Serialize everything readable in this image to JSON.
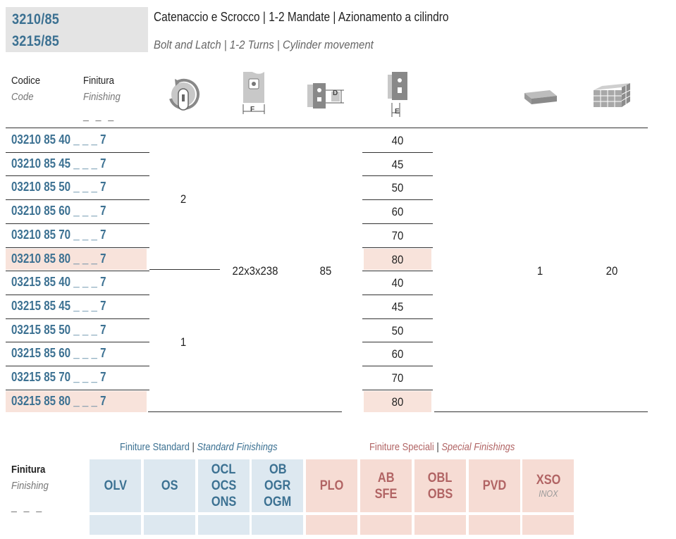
{
  "header": {
    "models": [
      "3210/85",
      "3215/85"
    ],
    "title_it": "Catenaccio e Scrocco | 1-2 Mandate | Azionamento a cilindro",
    "title_en": "Bolt and Latch | 1-2 Turns | Cylinder movement"
  },
  "columns": {
    "code_it": "Codice",
    "code_en": "Code",
    "finish_it": "Finitura",
    "finish_en": "Finishing",
    "finish_placeholder": "_ _ _",
    "icon_turns": "cylinder-turns-icon",
    "icon_faceplate": "faceplate-icon",
    "faceplate_label": "F",
    "icon_backset_d": "backset-icon",
    "backset_label": "D",
    "icon_backset_e": "entrance-icon",
    "entrance_label": "E",
    "icon_pack": "pack-icon",
    "icon_box": "box-icon"
  },
  "rows": [
    {
      "code": "03210 85 40 _ _ _ 7",
      "e": "40",
      "highlight": false
    },
    {
      "code": "03210 85 45 _ _ _ 7",
      "e": "45",
      "highlight": false
    },
    {
      "code": "03210 85 50 _ _ _ 7",
      "e": "50",
      "highlight": false
    },
    {
      "code": "03210 85 60 _ _ _ 7",
      "e": "60",
      "highlight": false
    },
    {
      "code": "03210 85 70 _ _ _ 7",
      "e": "70",
      "highlight": false
    },
    {
      "code": "03210 85 80 _ _ _ 7",
      "e": "80",
      "highlight": true
    },
    {
      "code": "03215 85 40 _ _ _ 7",
      "e": "40",
      "highlight": false
    },
    {
      "code": "03215 85 45 _ _ _ 7",
      "e": "45",
      "highlight": false
    },
    {
      "code": "03215 85 50 _ _ _ 7",
      "e": "50",
      "highlight": false
    },
    {
      "code": "03215 85 60 _ _ _ 7",
      "e": "60",
      "highlight": false
    },
    {
      "code": "03215 85 70 _ _ _ 7",
      "e": "70",
      "highlight": false
    },
    {
      "code": "03215 85 80 _ _ _ 7",
      "e": "80",
      "highlight": true
    }
  ],
  "merged": {
    "turns_group1": "2",
    "turns_group2": "1",
    "faceplate": "22x3x238",
    "backset": "85",
    "pack": "1",
    "box": "20"
  },
  "finishings": {
    "label_it": "Finitura",
    "label_en": "Finishing",
    "placeholder": "_ _ _",
    "standard_it": "Finiture Standard",
    "standard_sep": "|",
    "standard_en": "Standard Finishings",
    "special_it": "Finiture Speciali",
    "special_sep": "|",
    "special_en": "Special Finishings",
    "standard": [
      {
        "lines": [
          "OLV"
        ]
      },
      {
        "lines": [
          "OS"
        ]
      },
      {
        "lines": [
          "OCL",
          "OCS",
          "ONS"
        ]
      },
      {
        "lines": [
          "OB",
          "OGR",
          "OGM"
        ]
      }
    ],
    "special": [
      {
        "lines": [
          "PLO"
        ]
      },
      {
        "lines": [
          "AB",
          "SFE"
        ]
      },
      {
        "lines": [
          "OBL",
          "OBS"
        ]
      },
      {
        "lines": [
          "PVD"
        ]
      },
      {
        "lines": [
          "XSO"
        ],
        "sub": "INOX"
      }
    ]
  },
  "colors": {
    "blue": "#3c7192",
    "highlight": "#f8e3db",
    "standard_bg": "#dde8f0",
    "special_bg": "#f6dcd4",
    "special_text": "#b16464"
  }
}
